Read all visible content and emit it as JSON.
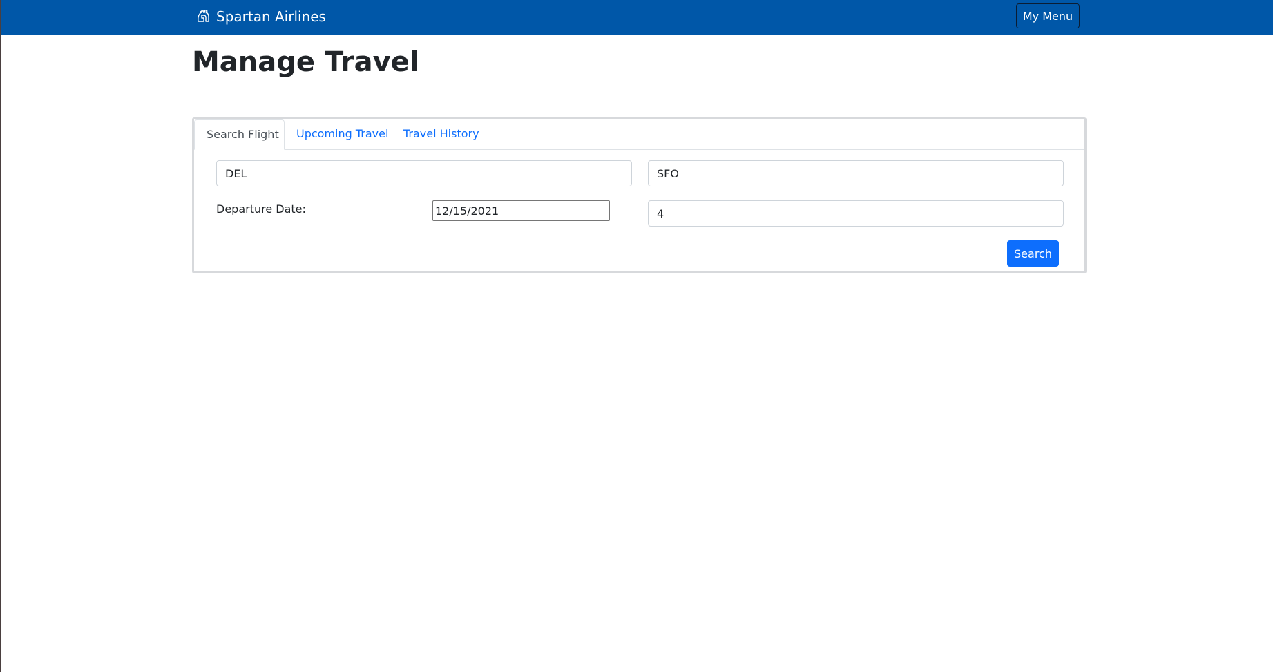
{
  "navbar": {
    "brand_icon": "spartan-helmet-icon",
    "brand_name": "Spartan Airlines",
    "menu_label": "My Menu",
    "color": "#0057a8"
  },
  "page": {
    "title": "Manage Travel"
  },
  "tabs": [
    {
      "label": "Search Flight",
      "active": true
    },
    {
      "label": "Upcoming Travel",
      "active": false
    },
    {
      "label": "Travel History",
      "active": false
    }
  ],
  "search_form": {
    "origin_value": "DEL",
    "destination_value": "SFO",
    "departure_label": "Departure Date:",
    "departure_value": "12/15/2021",
    "passengers_value": "4",
    "search_label": "Search"
  },
  "colors": {
    "accent": "#0d6efd",
    "link": "#0d6efd"
  }
}
